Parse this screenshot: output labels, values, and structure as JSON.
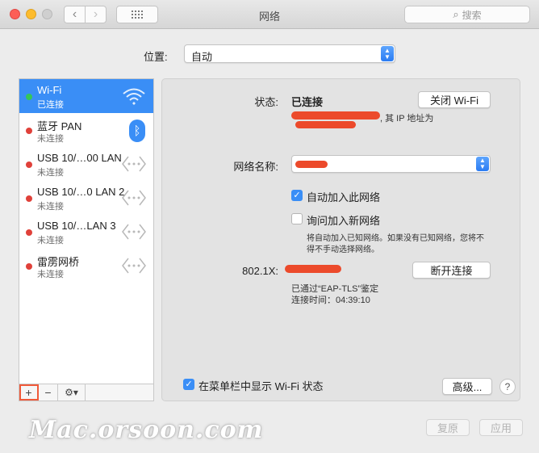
{
  "window": {
    "title": "网络"
  },
  "toolbar": {
    "search_placeholder": "搜索"
  },
  "location": {
    "label": "位置:",
    "value": "自动"
  },
  "services": [
    {
      "name": "Wi-Fi",
      "status": "已连接",
      "status_color": "#35c759",
      "icon": "wifi-icon",
      "selected": true
    },
    {
      "name": "蓝牙 PAN",
      "status": "未连接",
      "status_color": "#e0413a",
      "icon": "bluetooth-icon"
    },
    {
      "name": "USB 10/…00 LAN",
      "status": "未连接",
      "status_color": "#e0413a",
      "icon": "ethernet-icon"
    },
    {
      "name": "USB 10/…0 LAN 2",
      "status": "未连接",
      "status_color": "#e0413a",
      "icon": "ethernet-icon"
    },
    {
      "name": "USB 10/…LAN 3",
      "status": "未连接",
      "status_color": "#e0413a",
      "icon": "ethernet-icon"
    },
    {
      "name": "雷雳网桥",
      "status": "未连接",
      "status_color": "#e0413a",
      "icon": "ethernet-icon"
    }
  ],
  "sidebar_controls": {
    "add": "+",
    "remove": "−",
    "gear": "⚙▾"
  },
  "detail": {
    "status_label": "状态:",
    "status_value": "已连接",
    "wifi_off_button": "关闭 Wi-Fi",
    "ip_suffix": ", 其 IP 地址为",
    "network_name_label": "网络名称:",
    "auto_join_label": "自动加入此网络",
    "auto_join_checked": true,
    "ask_join_label": "询问加入新网络",
    "ask_join_checked": false,
    "ask_join_desc_1": "将自动加入已知网络。如果没有已知网络，您将不",
    "ask_join_desc_2": "得不手动选择网络。",
    "auth_label": "802.1X:",
    "disconnect_button": "断开连接",
    "auth_info": "已通过“EAP-TLS”鉴定",
    "connect_time": "连接时间：04:39:10",
    "menubar_label": "在菜单栏中显示 Wi-Fi 状态",
    "menubar_checked": true,
    "advanced_button": "高级...",
    "help": "?"
  },
  "footer": {
    "revert_button": "复原",
    "apply_button": "应用"
  },
  "watermark": "Mac.orsoon.com",
  "colors": {
    "accent": "#3a8ef6",
    "redaction": "#ec4a2b"
  }
}
